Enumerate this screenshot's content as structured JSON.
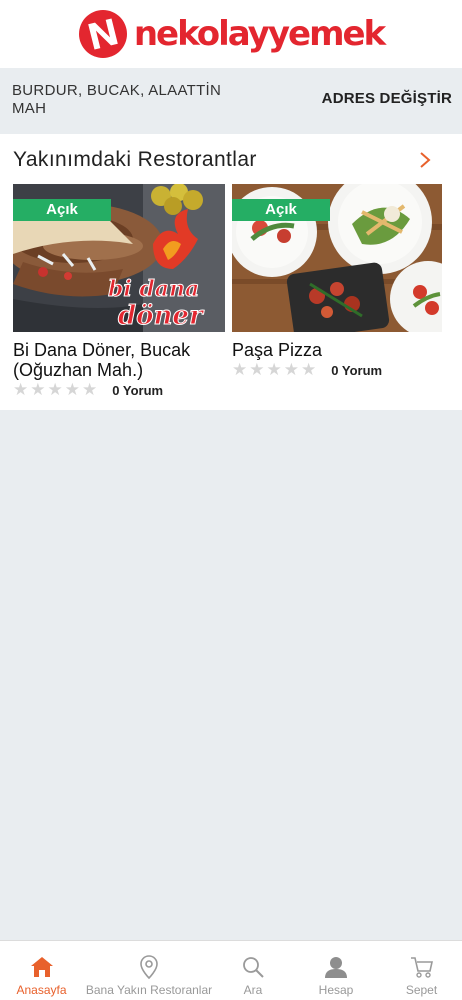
{
  "header": {
    "logo_text": "nekolayyemek",
    "logo_icon": "nekolayyemek-logo-icon",
    "brand_color": "#e3262f"
  },
  "address": {
    "text": "BURDUR, BUCAK, ALAATTİN MAH",
    "change_label": "ADRES DEĞİŞTİR"
  },
  "nearby": {
    "title": "Yakınımdaki Restorantlar",
    "more_icon": "chevron-right-icon",
    "accent_color": "#e8612c",
    "restaurants": [
      {
        "name": "Bi Dana Döner, Bucak (Oğuzhan Mah.)",
        "status": "Açık",
        "rating": 0,
        "rating_max": 5,
        "reviews": "0 Yorum",
        "logo_text_1": "bi dana",
        "logo_text_2": "döner"
      },
      {
        "name": "Paşa Pizza",
        "status": "Açık",
        "rating": 0,
        "rating_max": 5,
        "reviews": "0 Yorum"
      }
    ],
    "status_color": "#25ae64"
  },
  "nav": {
    "items": [
      {
        "label": "Anasayfa",
        "icon": "home-icon",
        "active": true
      },
      {
        "label": "Bana Yakın Restoranlar",
        "icon": "location-pin-icon",
        "active": false
      },
      {
        "label": "Ara",
        "icon": "search-icon",
        "active": false
      },
      {
        "label": "Hesap",
        "icon": "user-icon",
        "active": false
      },
      {
        "label": "Sepet",
        "icon": "cart-icon",
        "active": false
      }
    ]
  }
}
